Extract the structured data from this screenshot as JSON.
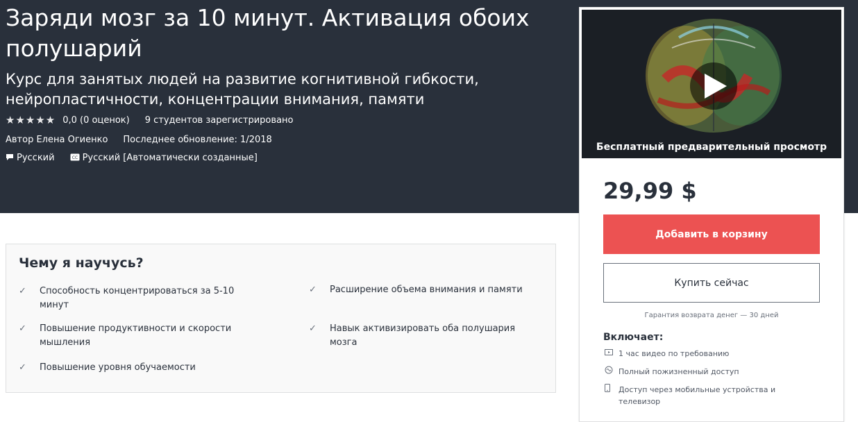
{
  "course": {
    "title": "Заряди мозг за 10 минут. Активация обоих полушарий",
    "subtitle": "Курс для занятых людей на развитие когнитивной гибкости, нейропластичности, концентрации внимания, памяти",
    "stars": "★★★★★",
    "rating": "0,0 (0 оценок)",
    "students": "9 студентов зарегистрировано",
    "author": "Автор Елена Огиенко",
    "updated": "Последнее обновление: 1/2018",
    "language": "Русский",
    "captions": "Русский [Автоматически созданные]"
  },
  "card": {
    "preview_caption": "Бесплатный предварительный просмотр",
    "price": "29,99 $",
    "add_to_cart": "Добавить в корзину",
    "buy_now": "Купить сейчас",
    "guarantee": "Гарантия возврата денег — 30 дней",
    "includes_title": "Включает:",
    "includes": [
      {
        "icon": "video-icon",
        "text": "1 час видео по требованию"
      },
      {
        "icon": "infinity-icon",
        "text": "Полный пожизненный доступ"
      },
      {
        "icon": "mobile-icon",
        "text": "Доступ через мобильные устройства и телевизор"
      }
    ]
  },
  "learn": {
    "title": "Чему я научусь?",
    "items": [
      "Способность концентрироваться за 5-10 минут",
      "Расширение объема внимания и памяти",
      "Повышение продуктивности и скорости мышления",
      "Навык активизировать оба полушария мозга",
      "Повышение уровня обучаемости"
    ]
  },
  "colors": {
    "hero_bg": "#29303b",
    "accent": "#ec5252",
    "card_border": "#dedfe0",
    "learn_bg": "#f9f9f9"
  }
}
